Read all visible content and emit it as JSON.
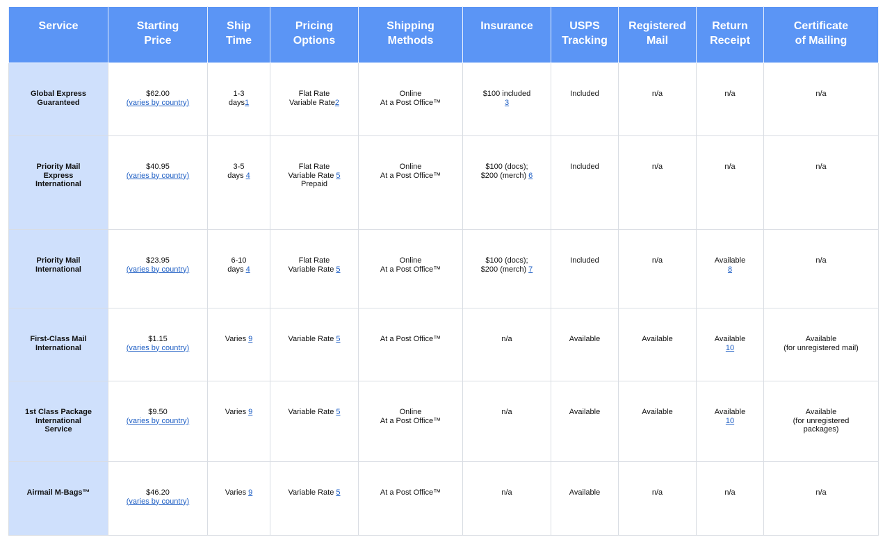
{
  "headers": [
    [
      "Service"
    ],
    [
      "Starting",
      "Price"
    ],
    [
      "Ship",
      "Time"
    ],
    [
      "Pricing",
      "Options"
    ],
    [
      "Shipping",
      "Methods"
    ],
    [
      "Insurance"
    ],
    [
      "USPS",
      "Tracking"
    ],
    [
      "Registered",
      "Mail"
    ],
    [
      "Return",
      "Receipt"
    ],
    [
      "Certificate",
      "of Mailing"
    ]
  ],
  "rows": [
    {
      "service": [
        "Global Express",
        "Guaranteed"
      ],
      "price": "$62.00",
      "price_link": "(varies by country)",
      "ship_time": [
        "1-3",
        "days"
      ],
      "ship_note": "1",
      "pricing": [
        {
          "t": "Flat Rate",
          "n": ""
        },
        {
          "t": "Variable Rate",
          "n": "2"
        }
      ],
      "methods": [
        "Online",
        "At a Post Office™"
      ],
      "insurance": [
        "$100 included"
      ],
      "insurance_note": "3",
      "tracking": "Included",
      "registered": "n/a",
      "return_receipt": "n/a",
      "return_note": "",
      "certificate": [
        "n/a"
      ]
    },
    {
      "service": [
        "Priority Mail",
        "Express",
        "International"
      ],
      "price": "$40.95",
      "price_link": "(varies by country)",
      "ship_time": [
        "3-5",
        "days "
      ],
      "ship_note": "4",
      "pricing": [
        {
          "t": "Flat Rate",
          "n": ""
        },
        {
          "t": "Variable Rate ",
          "n": "5"
        },
        {
          "t": "Prepaid",
          "n": ""
        }
      ],
      "methods": [
        "Online",
        "At a Post Office™"
      ],
      "insurance": [
        "$100 (docs);",
        "$200 (merch) "
      ],
      "insurance_note": "6",
      "tracking": "Included",
      "registered": "n/a",
      "return_receipt": "n/a",
      "return_note": "",
      "certificate": [
        "n/a"
      ]
    },
    {
      "service": [
        "Priority Mail",
        "International"
      ],
      "price": "$23.95",
      "price_link": "(varies by country)",
      "ship_time": [
        "6-10",
        "days "
      ],
      "ship_note": "4",
      "pricing": [
        {
          "t": "Flat Rate",
          "n": ""
        },
        {
          "t": "Variable Rate ",
          "n": "5"
        }
      ],
      "methods": [
        "Online",
        "At a Post Office™"
      ],
      "insurance": [
        "$100 (docs);",
        "$200 (merch) "
      ],
      "insurance_note": "7",
      "tracking": "Included",
      "registered": "n/a",
      "return_receipt": "Available",
      "return_note": "8",
      "certificate": [
        "n/a"
      ]
    },
    {
      "service": [
        "First-Class Mail",
        "International"
      ],
      "price": "$1.15",
      "price_link": "(varies by country)",
      "ship_time": [
        "Varies "
      ],
      "ship_note": "9",
      "pricing": [
        {
          "t": "Variable Rate ",
          "n": "5"
        }
      ],
      "methods": [
        "At a Post Office™"
      ],
      "insurance": [
        "n/a"
      ],
      "insurance_note": "",
      "tracking": "Available",
      "registered": "Available",
      "return_receipt": "Available",
      "return_note": "10",
      "certificate": [
        "Available",
        "(for unregistered mail)"
      ]
    },
    {
      "service": [
        "1st Class Package",
        "International",
        "Service"
      ],
      "price": "$9.50",
      "price_link": "(varies by country)",
      "ship_time": [
        "Varies "
      ],
      "ship_note": "9",
      "pricing": [
        {
          "t": "Variable Rate ",
          "n": "5"
        }
      ],
      "methods": [
        "Online",
        "At a Post Office™"
      ],
      "insurance": [
        "n/a"
      ],
      "insurance_note": "",
      "tracking": "Available",
      "registered": "Available",
      "return_receipt": "Available",
      "return_note": "10",
      "certificate": [
        "Available",
        "(for unregistered",
        "packages)"
      ]
    },
    {
      "service": [
        "Airmail M-Bags™"
      ],
      "price": "$46.20",
      "price_link": "(varies by country)",
      "ship_time": [
        "Varies "
      ],
      "ship_note": "9",
      "pricing": [
        {
          "t": "Variable Rate ",
          "n": "5"
        }
      ],
      "methods": [
        "At a Post Office™"
      ],
      "insurance": [
        "n/a"
      ],
      "insurance_note": "",
      "tracking": "Available",
      "registered": "n/a",
      "return_receipt": "n/a",
      "return_note": "",
      "certificate": [
        "n/a"
      ]
    }
  ]
}
